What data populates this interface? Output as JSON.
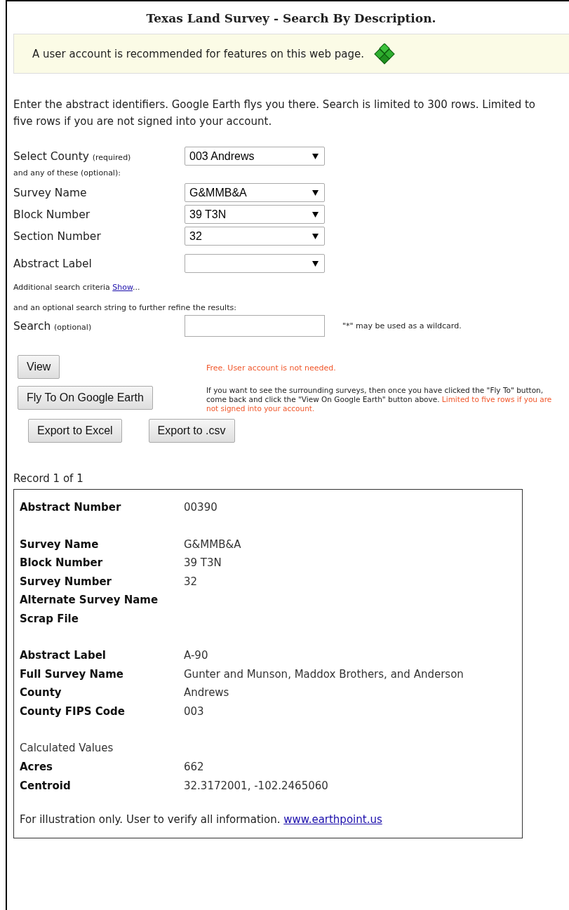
{
  "title": "Texas Land Survey - Search By Description.",
  "notice": {
    "text": "A user account is recommended for features on this web page."
  },
  "intro": "Enter the abstract identifiers. Google Earth flys you there. Search is limited to 300 rows. Limited to five rows if you are not signed into your account.",
  "county": {
    "label": "Select County",
    "note": "(required)",
    "value": "003 Andrews"
  },
  "optional_caption": "and any of these (optional):",
  "fields": [
    {
      "label": "Survey Name",
      "value": "G&MMB&A"
    },
    {
      "label": "Block Number",
      "value": "39 T3N"
    },
    {
      "label": "Section Number",
      "value": "32"
    },
    {
      "label": "Abstract Label"
    }
  ],
  "additional": {
    "text": "Additional search criteria",
    "link": "Show",
    "suffix": "..."
  },
  "refine_caption": "and an optional search string to further refine the results:",
  "search": {
    "label": "Search",
    "note": "(optional)",
    "hint": "\"*\" may be used as a wildcard."
  },
  "view_button": "View",
  "view_note": "Free. User account is not needed.",
  "fly_button": "Fly To On Google Earth",
  "fly_note": {
    "text": "If you want to see the surrounding surveys, then once you have clicked the \"Fly To\" button, come back and click the \"View On Google Earth\" button above.",
    "warning": "Limited to five rows if you are not signed into your account."
  },
  "export_buttons": [
    "Export to Excel",
    "Export to .csv"
  ],
  "record_count": "Record 1 of 1",
  "record_groups": [
    {
      "rows": [
        {
          "label": "Abstract Number",
          "value": "00390"
        }
      ]
    },
    {
      "rows": [
        {
          "label": "Survey Name",
          "value": "G&MMB&A"
        },
        {
          "label": "Block Number",
          "value": "39 T3N"
        },
        {
          "label": "Survey Number",
          "value": "32"
        },
        {
          "label": "Alternate Survey Name"
        },
        {
          "label": "Scrap File"
        }
      ]
    },
    {
      "rows": [
        {
          "label": "Abstract Label",
          "value": "A-90"
        },
        {
          "label": "Full Survey Name",
          "value": "Gunter and Munson, Maddox Brothers, and Anderson"
        },
        {
          "label": "County",
          "value": "Andrews"
        },
        {
          "label": "County FIPS Code",
          "value": "003"
        }
      ]
    },
    {
      "heading": "Calculated Values",
      "rows": [
        {
          "label": "Acres",
          "value": "662"
        },
        {
          "label": "Centroid",
          "value": "32.3172001, -102.2465060"
        }
      ]
    }
  ],
  "footer": {
    "text": "For illustration only.  User to verify all information.",
    "link": "www.earthpoint.us"
  }
}
